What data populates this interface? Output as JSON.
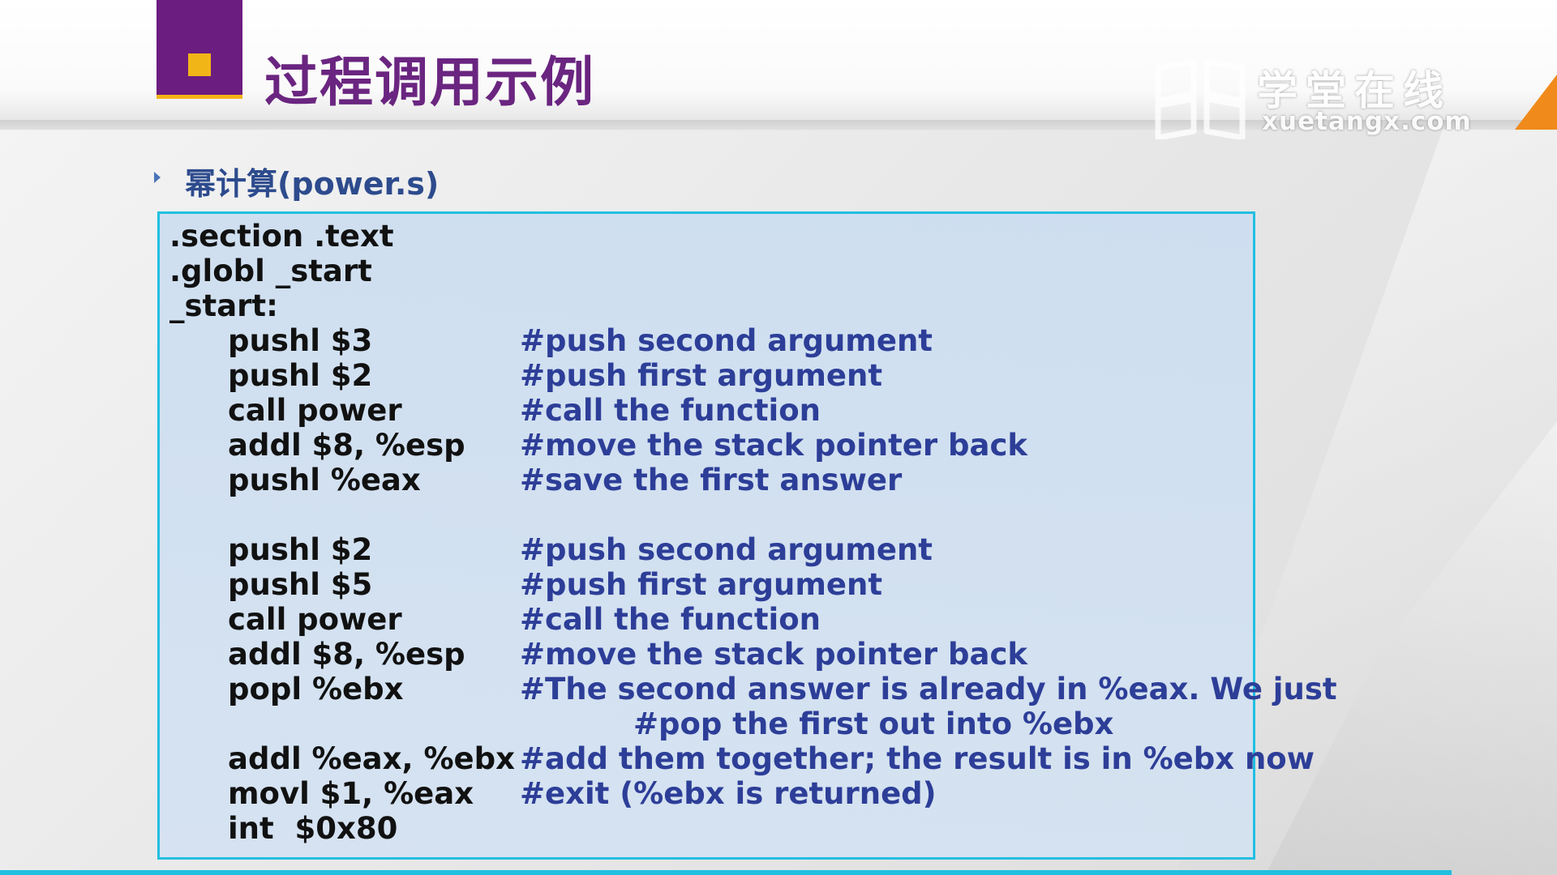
{
  "slide": {
    "title": "过程调用示例",
    "subtitle": "幂计算(power.s)",
    "colors": {
      "accent_purple": "#6c1d80",
      "accent_gold": "#f2b518",
      "title": "#6a2580",
      "code_border": "#22bfe0",
      "comment": "#2d3e98",
      "orange": "#f08a1b"
    }
  },
  "logo": {
    "chinese": "学堂在线",
    "domain": "xuetangx.com",
    "icon": "book-icon"
  },
  "code": {
    "top_lines": [
      ".section .text",
      ".globl _start",
      "_start:"
    ],
    "block1": [
      {
        "instr": "pushl $3",
        "comment": "#push second argument"
      },
      {
        "instr": "pushl $2",
        "comment": "#push first argument"
      },
      {
        "instr": "call power",
        "comment": "#call the function"
      },
      {
        "instr": "addl $8, %esp",
        "comment": "#move the stack pointer back"
      },
      {
        "instr": "pushl %eax",
        "comment": "#save the first answer"
      }
    ],
    "block2": [
      {
        "instr": "pushl $2",
        "comment": "#push second argument"
      },
      {
        "instr": "pushl $5",
        "comment": "#push first argument"
      },
      {
        "instr": "call power",
        "comment": "#call the function"
      },
      {
        "instr": "addl $8, %esp",
        "comment": "#move the stack pointer back"
      },
      {
        "instr": "popl %ebx",
        "comment": "#The second answer is already in %eax. We just"
      },
      {
        "instr": "",
        "comment": "#pop the first out into %ebx"
      },
      {
        "instr": "addl %eax, %ebx",
        "comment": "#add them together; the result is in %ebx now"
      },
      {
        "instr": "movl $1, %eax",
        "comment": "#exit (%ebx is returned)"
      },
      {
        "instr": "int  $0x80",
        "comment": ""
      }
    ]
  }
}
